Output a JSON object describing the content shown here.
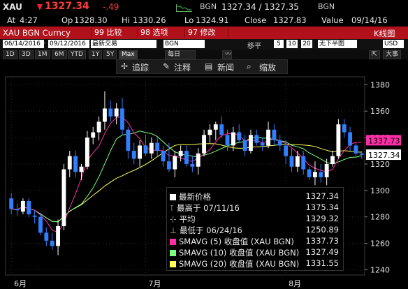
{
  "quote": {
    "symbol": "XAU",
    "last": "1327.34",
    "change": "-.49",
    "source1": "BGN",
    "bid_ask": "1327.34 / 1327.35",
    "source2": "BGN",
    "at_label": "At",
    "at_time": "4:27",
    "open_label": "Op",
    "open": "1328.30",
    "high_label": "Hi",
    "high": "1330.26",
    "low_label": "Lo",
    "low": "1324.91",
    "close_label": "Close",
    "close": "1327.83",
    "value_label": "Value",
    "value_date": "09/14/16"
  },
  "menu": {
    "title": "XAU BGN Curncy",
    "btn_compare": "99 比较",
    "btn_options": "98 选项",
    "btn_edit": "97 修改",
    "chart_name": "K线图"
  },
  "controls": {
    "date_from": "06/14/2016",
    "date_to": "09/12/2016",
    "last_trade": "最新交易",
    "source": "BGN",
    "shift_label": "移平",
    "shift_values": [
      "5",
      "10",
      "20"
    ],
    "bottom_half": "无下半图",
    "currency": "USD"
  },
  "periods": [
    "1D",
    "3D",
    "1M",
    "6M",
    "YTD",
    "1Y",
    "5Y",
    "Max"
  ],
  "active_period": "Max",
  "freq": "每日",
  "zoom": "大事",
  "toolbar": {
    "track": "追踪",
    "annotate": "注释",
    "news": "新闻",
    "zoom": "缩放"
  },
  "legend": {
    "last_price_label": "最新价格",
    "last_price": "1327.34",
    "high_label": "最高于 07/11/16",
    "high": "1375.34",
    "avg_label": "平均",
    "avg": "1329.32",
    "low_label": "最低于 06/24/16",
    "low": "1250.89",
    "sma5_label": "SMAVG (5) 收盘值 (XAU BGN)",
    "sma5": "1337.73",
    "sma10_label": "SMAVG (10) 收盘值 (XAU BGN)",
    "sma10": "1327.49",
    "sma20_label": "SMAVG (20) 收盘值 (XAU BGN)",
    "sma20": "1331.55"
  },
  "colors": {
    "up": "#ffffff",
    "down": "#2f7fff",
    "sma5": "#ff2da6",
    "sma10": "#7cff7c",
    "sma20": "#ffff5a",
    "accent": "#b1111a"
  },
  "chart_data": {
    "type": "candlestick",
    "x_labels": [
      "6月",
      "7月",
      "8月"
    ],
    "y_ticks": [
      1240,
      1260,
      1280,
      1300,
      1320,
      1340,
      1360,
      1380
    ],
    "ylim": [
      1236,
      1386
    ],
    "price_tag": "1327.34",
    "sma5_tag": "1337.73",
    "candles": [
      [
        1294,
        1298,
        1282,
        1286
      ],
      [
        1286,
        1290,
        1281,
        1285
      ],
      [
        1284,
        1294,
        1282,
        1292
      ],
      [
        1292,
        1294,
        1280,
        1282
      ],
      [
        1281,
        1285,
        1275,
        1280
      ],
      [
        1280,
        1283,
        1266,
        1268
      ],
      [
        1268,
        1272,
        1258,
        1262
      ],
      [
        1262,
        1268,
        1255,
        1258
      ],
      [
        1258,
        1278,
        1251,
        1273
      ],
      [
        1273,
        1320,
        1270,
        1316
      ],
      [
        1316,
        1330,
        1310,
        1326
      ],
      [
        1326,
        1330,
        1310,
        1314
      ],
      [
        1314,
        1320,
        1308,
        1318
      ],
      [
        1318,
        1345,
        1316,
        1340
      ],
      [
        1340,
        1348,
        1335,
        1344
      ],
      [
        1344,
        1356,
        1338,
        1352
      ],
      [
        1352,
        1375,
        1346,
        1362
      ],
      [
        1362,
        1368,
        1352,
        1356
      ],
      [
        1356,
        1366,
        1350,
        1362
      ],
      [
        1362,
        1370,
        1342,
        1346
      ],
      [
        1346,
        1348,
        1324,
        1330
      ],
      [
        1330,
        1336,
        1320,
        1324
      ],
      [
        1324,
        1338,
        1318,
        1334
      ],
      [
        1334,
        1342,
        1326,
        1328
      ],
      [
        1328,
        1340,
        1324,
        1336
      ],
      [
        1336,
        1340,
        1326,
        1330
      ],
      [
        1330,
        1334,
        1318,
        1322
      ],
      [
        1322,
        1336,
        1314,
        1316
      ],
      [
        1316,
        1330,
        1310,
        1326
      ],
      [
        1326,
        1334,
        1322,
        1330
      ],
      [
        1330,
        1334,
        1318,
        1320
      ],
      [
        1320,
        1326,
        1314,
        1318
      ],
      [
        1318,
        1332,
        1312,
        1328
      ],
      [
        1328,
        1346,
        1326,
        1342
      ],
      [
        1342,
        1350,
        1336,
        1346
      ],
      [
        1346,
        1352,
        1338,
        1350
      ],
      [
        1350,
        1356,
        1340,
        1342
      ],
      [
        1342,
        1346,
        1330,
        1334
      ],
      [
        1334,
        1348,
        1330,
        1344
      ],
      [
        1344,
        1350,
        1336,
        1338
      ],
      [
        1338,
        1342,
        1326,
        1330
      ],
      [
        1330,
        1346,
        1328,
        1342
      ],
      [
        1342,
        1346,
        1334,
        1336
      ],
      [
        1336,
        1340,
        1330,
        1334
      ],
      [
        1334,
        1352,
        1332,
        1346
      ],
      [
        1346,
        1350,
        1334,
        1338
      ],
      [
        1338,
        1342,
        1330,
        1334
      ],
      [
        1334,
        1338,
        1320,
        1326
      ],
      [
        1326,
        1332,
        1314,
        1318
      ],
      [
        1318,
        1330,
        1314,
        1326
      ],
      [
        1326,
        1330,
        1312,
        1316
      ],
      [
        1316,
        1318,
        1308,
        1310
      ],
      [
        1310,
        1322,
        1304,
        1314
      ],
      [
        1314,
        1320,
        1306,
        1310
      ],
      [
        1310,
        1324,
        1304,
        1320
      ],
      [
        1320,
        1330,
        1318,
        1326
      ],
      [
        1326,
        1354,
        1324,
        1350
      ],
      [
        1350,
        1354,
        1340,
        1344
      ],
      [
        1344,
        1348,
        1330,
        1334
      ],
      [
        1334,
        1336,
        1326,
        1328
      ],
      [
        1328,
        1330,
        1324,
        1327
      ]
    ]
  }
}
